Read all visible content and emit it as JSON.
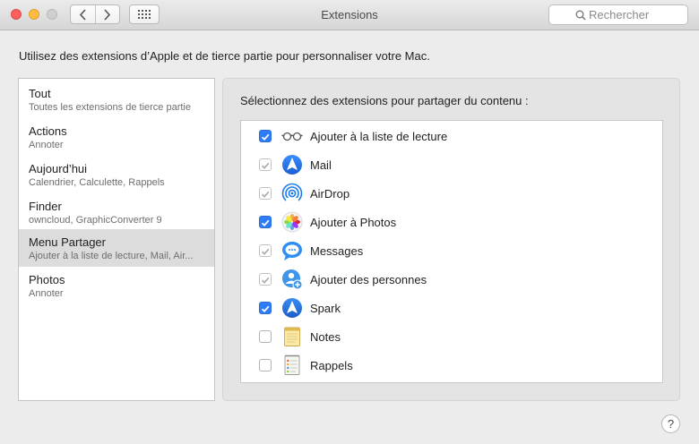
{
  "window": {
    "title": "Extensions"
  },
  "search": {
    "placeholder": "Rechercher"
  },
  "description": "Utilisez des extensions d’Apple et de tierce partie pour personnaliser votre Mac.",
  "sidebar": {
    "items": [
      {
        "title": "Tout",
        "subtitle": "Toutes les extensions de tierce partie"
      },
      {
        "title": "Actions",
        "subtitle": "Annoter"
      },
      {
        "title": "Aujourd’hui",
        "subtitle": "Calendrier, Calculette, Rappels"
      },
      {
        "title": "Finder",
        "subtitle": "owncloud, GraphicConverter 9"
      },
      {
        "title": "Menu Partager",
        "subtitle": "Ajouter à la liste de lecture, Mail, Air...",
        "selected": true
      },
      {
        "title": "Photos",
        "subtitle": "Annoter"
      }
    ]
  },
  "panel": {
    "label": "Sélectionnez des extensions pour partager du contenu :",
    "items": [
      {
        "label": "Ajouter à la liste de lecture",
        "icon": "reading-glasses-icon",
        "state": "checked"
      },
      {
        "label": "Mail",
        "icon": "mail-icon",
        "state": "checked-disabled"
      },
      {
        "label": "AirDrop",
        "icon": "airdrop-icon",
        "state": "checked-disabled"
      },
      {
        "label": "Ajouter à Photos",
        "icon": "photos-icon",
        "state": "checked"
      },
      {
        "label": "Messages",
        "icon": "messages-icon",
        "state": "checked-disabled"
      },
      {
        "label": "Ajouter des personnes",
        "icon": "add-people-icon",
        "state": "checked-disabled"
      },
      {
        "label": "Spark",
        "icon": "spark-icon",
        "state": "checked"
      },
      {
        "label": "Notes",
        "icon": "notes-icon",
        "state": "unchecked"
      },
      {
        "label": "Rappels",
        "icon": "reminders-icon",
        "state": "unchecked"
      }
    ]
  },
  "help": {
    "label": "?"
  },
  "colors": {
    "accent": "#2e7cf6",
    "selected_row": "#dcdcdc"
  }
}
